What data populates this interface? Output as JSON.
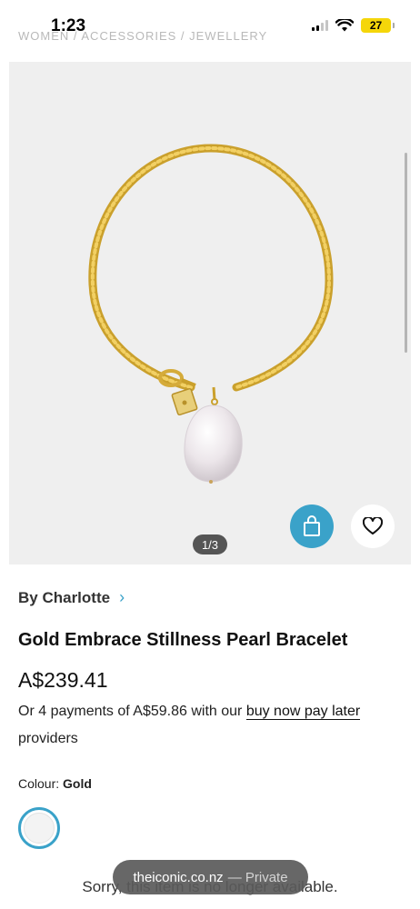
{
  "status_bar": {
    "time": "1:23",
    "battery": "27",
    "battery_color": "#f5d60a"
  },
  "breadcrumb": "WOMEN / ACCESSORIES / JEWELLERY",
  "gallery": {
    "counter": "1/3",
    "bag_icon": "shopping-bag-icon",
    "wishlist_icon": "heart-icon",
    "accent_color": "#3aa2c9"
  },
  "product": {
    "brand": "By Charlotte",
    "title": "Gold Embrace Stillness Pearl Bracelet",
    "price": "A$239.41",
    "bnpl_prefix": "Or 4 payments of A$59.86 with our ",
    "bnpl_link": "buy now pay later",
    "bnpl_suffix": " providers"
  },
  "colour": {
    "label": "Colour:",
    "value": "Gold"
  },
  "unavailable_text": "Sorry, this item is no longer available.",
  "browser": {
    "domain": "theiconic.co.nz",
    "mode": "— Private"
  }
}
